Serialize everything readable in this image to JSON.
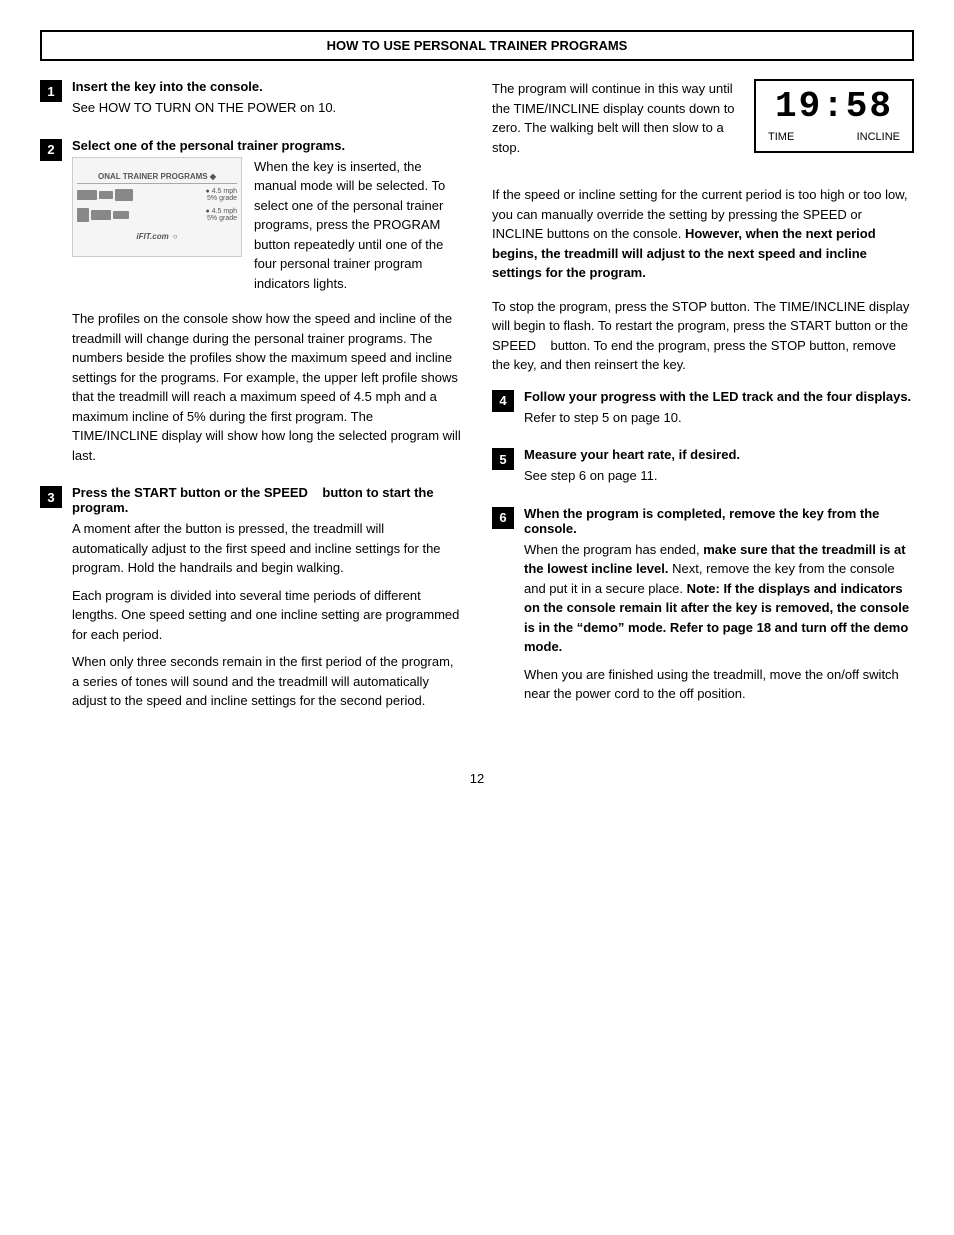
{
  "page": {
    "number": "12"
  },
  "section": {
    "title": "HOW TO USE PERSONAL TRAINER PROGRAMS"
  },
  "steps": [
    {
      "num": "1",
      "heading": "Insert the key into the console.",
      "body": "See HOW TO TURN ON THE POWER on 10."
    },
    {
      "num": "2",
      "heading": "Select one of the personal trainer programs.",
      "body_parts": [
        "When the key is inserted, the manual mode will be selected. To select one of the personal trainer programs, press the PROGRAM button repeatedly until one of the four personal trainer program indicators lights.",
        "The profiles on the console show how the speed and incline of the treadmill will change during the personal trainer programs. The numbers beside the profiles show the maximum speed and incline settings for the programs. For example, the upper left profile shows that the treadmill will reach a maximum speed of 4.5 mph and a maximum incline of 5% during the first program. The TIME/INCLINE display will show how long the selected program will last."
      ]
    },
    {
      "num": "3",
      "heading": "Press the START button or the SPEED    button to start the program.",
      "body_parts": [
        "A moment after the button is pressed, the treadmill will automatically adjust to the first speed and incline settings for the program. Hold the handrails and begin walking.",
        "Each program is divided into several time periods of different lengths. One speed setting and one incline setting are programmed for each period.",
        "When only three seconds remain in the first period of the program, a series of tones will sound and the treadmill will automatically adjust to the speed and incline settings for the second period."
      ]
    }
  ],
  "right_steps": [
    {
      "num": "4",
      "heading": "Follow your progress with the LED track and the four displays.",
      "body": "Refer to step 5 on page 10."
    },
    {
      "num": "5",
      "heading": "Measure your heart rate, if desired.",
      "body": "See step 6 on page 11."
    },
    {
      "num": "6",
      "heading": "When the program is completed, remove the key from the console.",
      "body_parts": [
        "When the program has ended, make sure that the treadmill is at the lowest incline level. Next, remove the key from the console and put it in a secure place. Note: If the displays and indicators on the console remain lit after the key is removed, the console is in the “demo” mode. Refer to page 18 and turn off the demo mode.",
        "When you are finished using the treadmill, move the on/off switch near the power cord to the off position."
      ]
    }
  ],
  "right_intro": {
    "para1": "The program will continue in this way until the TIME/INCLINE display counts down to zero. The walking belt will then slow to a stop.",
    "para2": "If the speed or incline setting for the current period is too high or too low, you can manually override the setting by pressing the SPEED or INCLINE buttons on the console.",
    "para2_bold": "However, when the next period begins, the treadmill will adjust to the next speed and incline settings for the program.",
    "para3": "To stop the program, press the STOP button. The TIME/INCLINE display will begin to flash. To restart the program, press the START button or the SPEED    button. To end the program, press the STOP button, remove the key, and then reinsert the key."
  },
  "display": {
    "digits": "19:58",
    "label_left": "TIME",
    "label_right": "INCLINE"
  },
  "console_image": {
    "title": "ONAL TRAINER PROGRAMS",
    "speed_labels": [
      "4.5 mph / 5% grade",
      "4.5 mph / 5% grade"
    ],
    "footer": "iFIT.com"
  }
}
